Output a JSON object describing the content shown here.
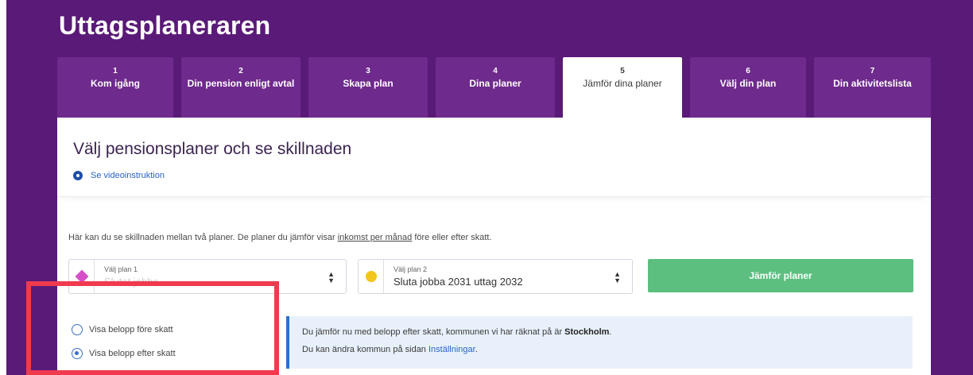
{
  "app": {
    "title": "Uttagsplaneraren"
  },
  "tabs": [
    {
      "num": "1",
      "label": "Kom igång"
    },
    {
      "num": "2",
      "label": "Din pension enligt avtal"
    },
    {
      "num": "3",
      "label": "Skapa plan"
    },
    {
      "num": "4",
      "label": "Dina planer"
    },
    {
      "num": "5",
      "label": "Jämför dina planer"
    },
    {
      "num": "6",
      "label": "Välj din plan"
    },
    {
      "num": "7",
      "label": "Din aktivitetslista"
    }
  ],
  "active_tab": 5,
  "header": {
    "heading": "Välj pensionsplaner och se skillnaden",
    "video_link": "Se videoinstruktion"
  },
  "description": {
    "before": "Här kan du se skillnaden mellan två planer. De planer du jämför visar ",
    "link": "inkomst per månad",
    "after": " före eller efter skatt."
  },
  "plan1": {
    "caption": "Välj plan 1",
    "value": "Slutat jobba"
  },
  "plan2": {
    "caption": "Välj plan 2",
    "value": "Sluta jobba 2031 uttag 2032"
  },
  "compare_button": "Jämför planer",
  "radios": [
    {
      "label": "Visa belopp före skatt",
      "checked": false
    },
    {
      "label": "Visa belopp efter skatt",
      "checked": true
    }
  ],
  "info": {
    "line1_prefix": "Du jämför nu med belopp efter skatt, kommunen vi har räknat på är ",
    "line1_bold": "Stockholm",
    "line1_suffix": ".",
    "line2_prefix": "Du kan ändra kommun på sidan ",
    "line2_link": "Inställningar",
    "line2_suffix": "."
  },
  "colors": {
    "brand_purple": "#5a1a78",
    "tab_purple": "#6e2a8c",
    "compare_green": "#5cbf7f",
    "highlight_red": "#f03a4e",
    "info_blue": "#2a6fd6"
  }
}
